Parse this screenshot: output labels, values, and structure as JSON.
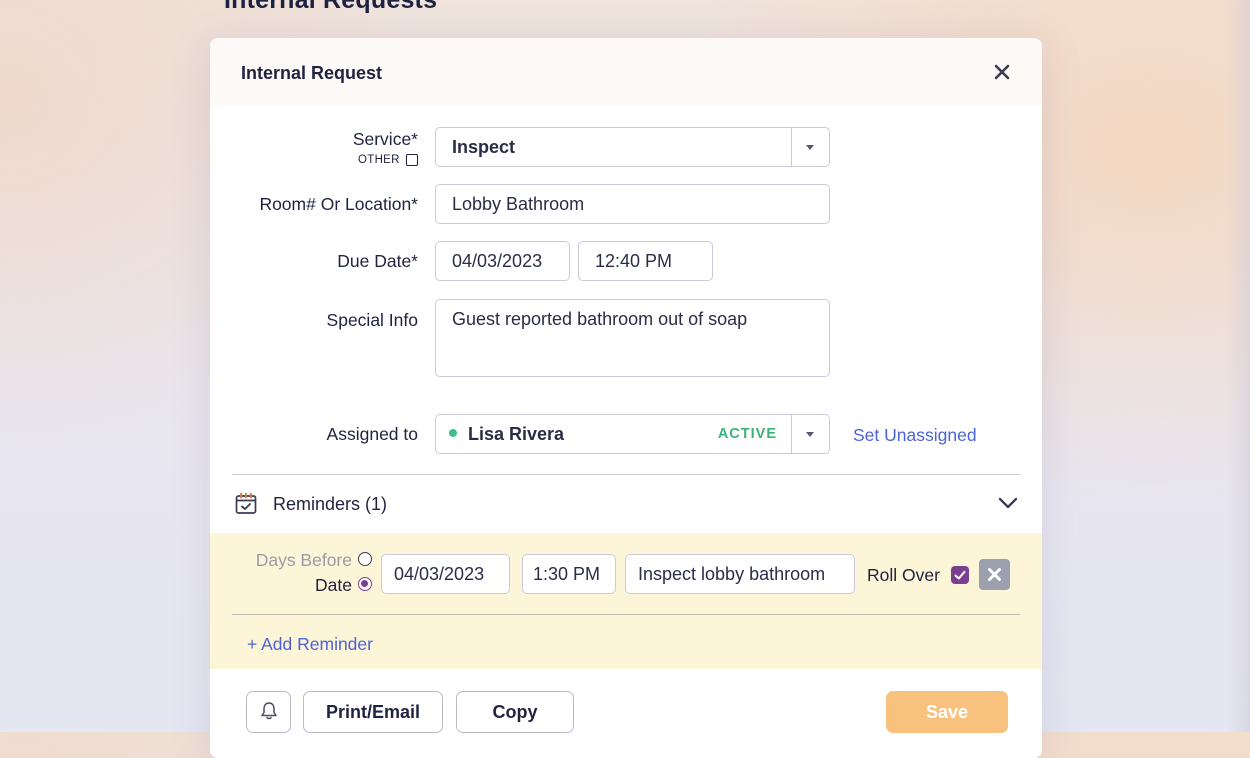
{
  "page": {
    "title": "Internal Requests"
  },
  "modal": {
    "title": "Internal Request"
  },
  "form": {
    "service": {
      "label": "Service*",
      "other_label": "OTHER",
      "value": "Inspect"
    },
    "location": {
      "label": "Room# Or Location*",
      "value": "Lobby Bathroom"
    },
    "due": {
      "label": "Due Date*",
      "date": "04/03/2023",
      "time": "12:40 PM"
    },
    "special": {
      "label": "Special Info",
      "value": "Guest reported bathroom out of soap"
    },
    "assigned": {
      "label": "Assigned to",
      "name": "Lisa Rivera",
      "status": "ACTIVE",
      "status_color": "#3cb37d",
      "unassign_label": "Set Unassigned"
    }
  },
  "reminders": {
    "title": "Reminders (1)",
    "days_before_label": "Days Before",
    "date_label": "Date",
    "selected_mode": "Date",
    "item": {
      "date": "04/03/2023",
      "time": "1:30 PM",
      "text": "Inspect lobby bathroom",
      "rollover_label": "Roll Over",
      "rollover_checked": true
    },
    "add_label": "+ Add Reminder"
  },
  "footer": {
    "print_label": "Print/Email",
    "copy_label": "Copy",
    "save_label": "Save"
  },
  "colors": {
    "accent_purple": "#7b3f8f",
    "link_blue": "#4d63d6",
    "save_orange": "#f8c27e",
    "reminder_band": "#fdf5d8"
  },
  "icons": [
    "close-icon",
    "calendar-check-icon",
    "chevron-down-icon",
    "bell-icon",
    "dropdown-arrow-icon",
    "checkmark-icon"
  ]
}
